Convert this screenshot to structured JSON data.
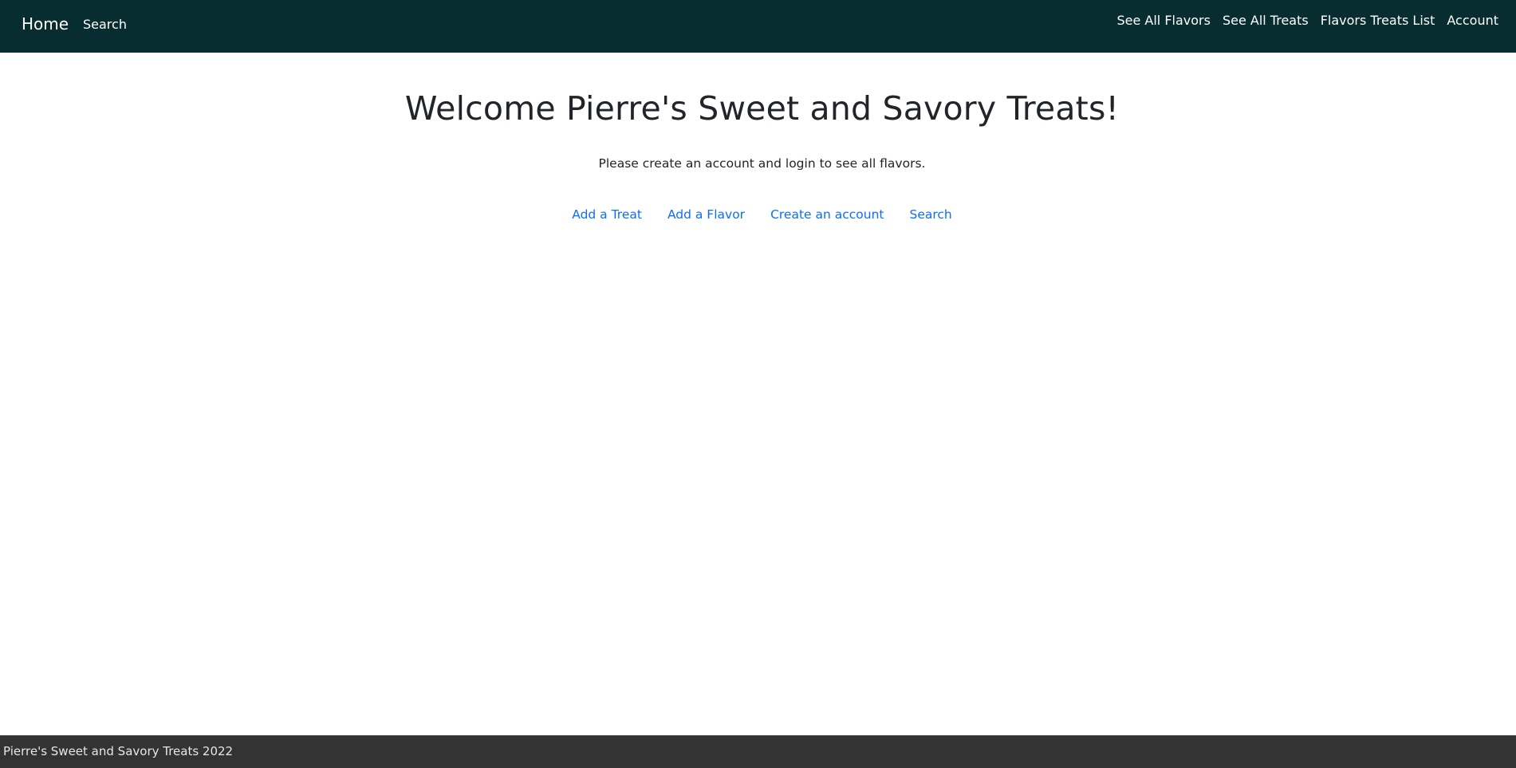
{
  "navbar": {
    "brand": "Home",
    "search": "Search",
    "right_links": [
      "See All Flavors",
      "See All Treats",
      "Flavors Treats List",
      "Account"
    ]
  },
  "main": {
    "title": "Welcome Pierre's Sweet and Savory Treats!",
    "message": "Please create an account and login to see all flavors.",
    "links": [
      "Add a Treat",
      "Add a Flavor",
      "Create an account",
      "Search"
    ]
  },
  "footer": {
    "text": "Pierre's Sweet and Savory Treats 2022"
  },
  "colors": {
    "navbar_bg": "#072d30",
    "footer_bg": "#333333",
    "link": "#0d6efd",
    "text": "#212529"
  }
}
